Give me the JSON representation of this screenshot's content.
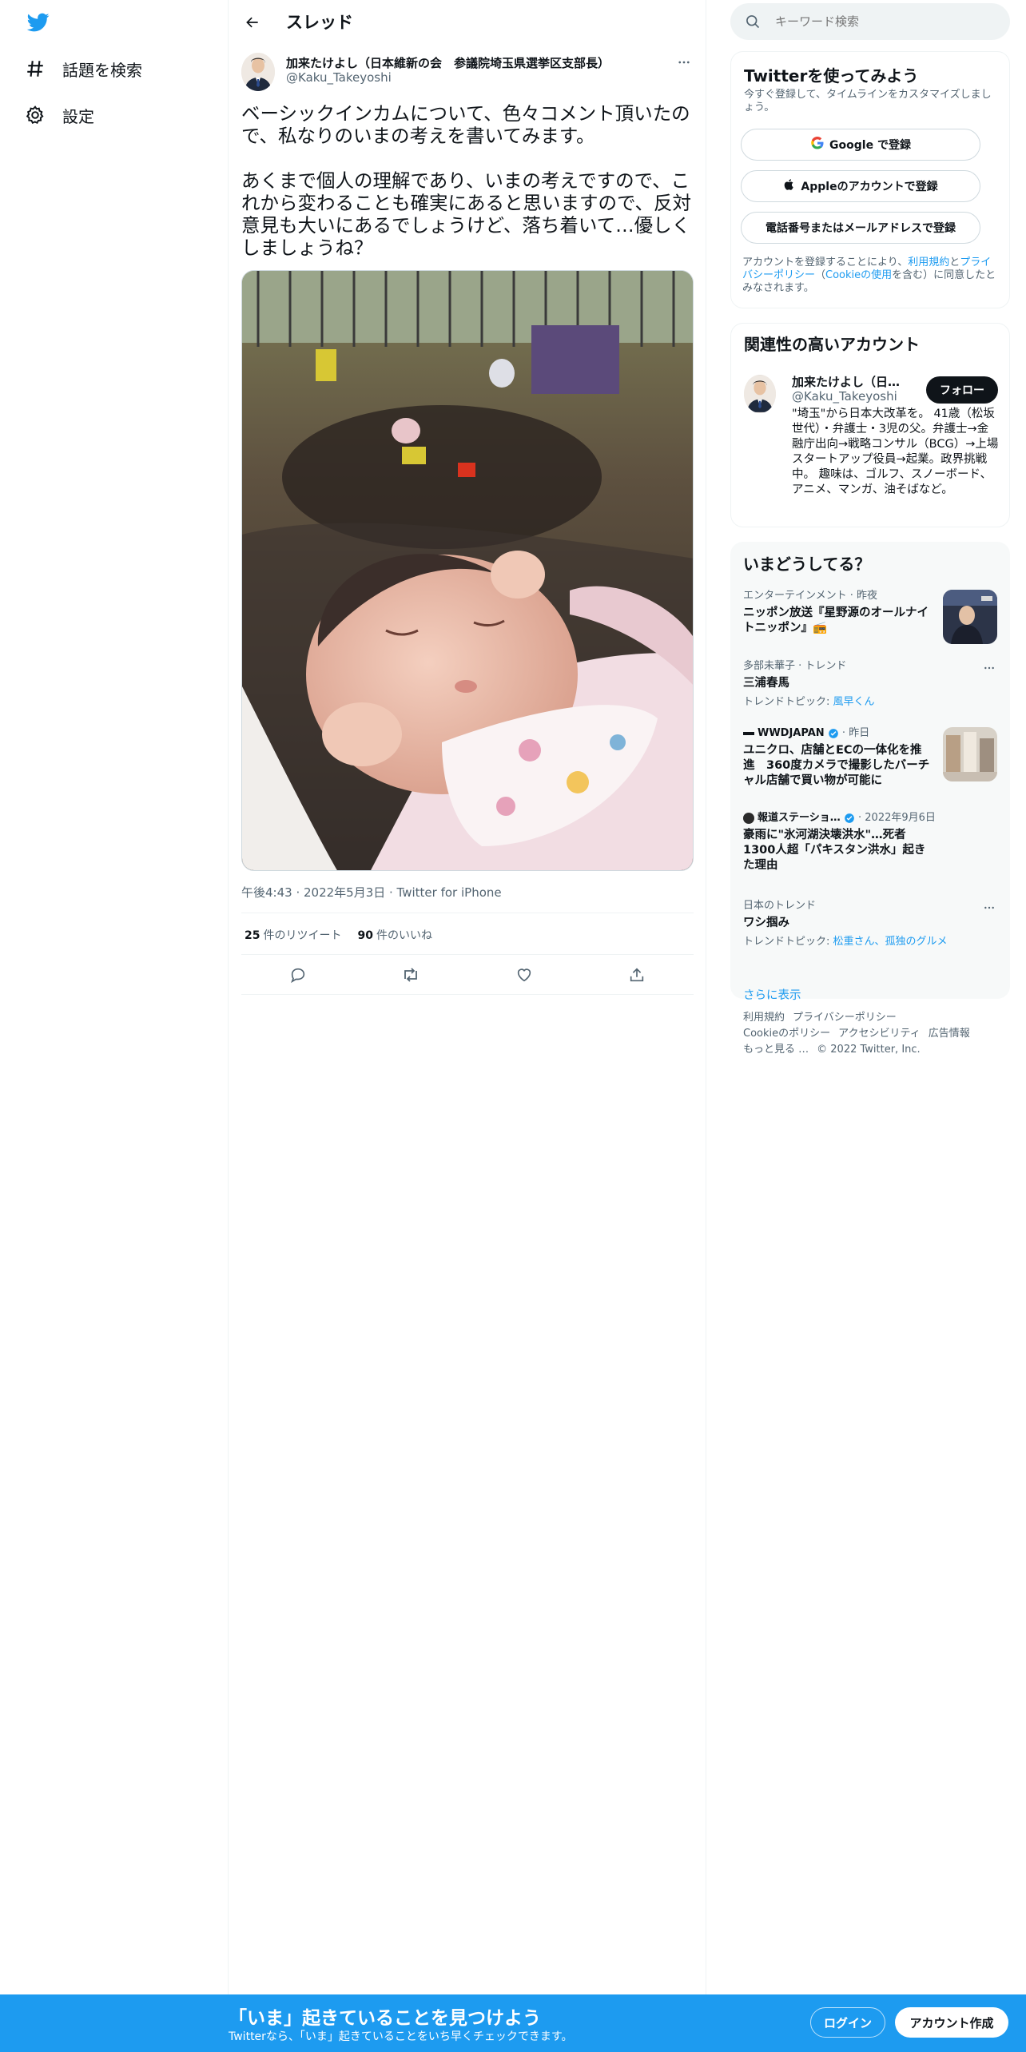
{
  "nav": {
    "logo_icon": "twitter-bird-icon",
    "explore_label": "話題を検索",
    "settings_label": "設定"
  },
  "main": {
    "header_title": "スレッド",
    "author_name": "加来たけよし（日本維新の会　参議院埼玉県選挙区支部長）",
    "author_handle": "@Kaku_Takeyoshi",
    "tweet_text": "ベーシックインカムについて、色々コメント頂いたので、私なりのいまの考えを書いてみます。\n\nあくまで個人の理解であり、いまの考えですので、これから変わることも確実にあると思いますので、反対意見も大いにあるでしょうけど、落ち着いて…優しくしましょうね？",
    "meta": "午後4:43 · 2022年5月3日 · Twitter for iPhone",
    "retweet_count": "25",
    "retweet_label": "件のリツイート",
    "like_count": "90",
    "like_label": "件のいいね"
  },
  "right": {
    "search_placeholder": "キーワード検索",
    "signup": {
      "title": "Twitterを使ってみよう",
      "subtitle": "今すぐ登録して、タイムラインをカスタマイズしましょう。",
      "google_label": "Google で登録",
      "apple_label": "Appleのアカウントで登録",
      "phone_label": "電話番号またはメールアドレスで登録",
      "legal_prefix": "アカウントを登録することにより、",
      "legal_terms": "利用規約",
      "legal_and": "と",
      "legal_privacy": "プライバシーポリシー",
      "legal_paren_open": "（",
      "legal_cookie": "Cookieの使用",
      "legal_suffix": "を含む）に同意したとみなされます。"
    },
    "related": {
      "title": "関連性の高いアカウント",
      "name": "加来たけよし（日本維新の会　参議院埼玉県選挙区支部長）",
      "handle": "@Kaku_Takeyoshi",
      "follow_label": "フォロー",
      "bio": "\"埼玉\"から日本大改革を。 41歳（松坂世代）・弁護士・3児の父。弁護士→金融庁出向→戦略コンサル（BCG）→上場スタートアップ役員→起業。政界挑戦中。 趣味は、ゴルフ、スノーボード、アニメ、マンガ、油そばなど。"
    },
    "trends": {
      "title": "いまどうしてる？",
      "items": [
        {
          "category": "エンターテインメント · 昨夜",
          "title": "ニッポン放送『星野源のオールナイトニッポン』📻",
          "sub": ""
        },
        {
          "category": "多部未華子 · トレンド",
          "title": "三浦春馬",
          "sub_prefix": "トレンドトピック: ",
          "sub": "風早くん"
        },
        {
          "category": "WWDJAPAN",
          "category_suffix": " · 昨日",
          "title": "ユニクロ、店舗とECの一体化を推進　360度カメラで撮影したバーチャル店舗で買い物が可能に",
          "sub": ""
        },
        {
          "category": "報道ステーショ…",
          "category_suffix": " · 2022年9月6日",
          "title": "豪雨に\"氷河湖決壊洪水\"…死者1300人超「パキスタン洪水」起きた理由",
          "sub": ""
        },
        {
          "category": "日本のトレンド",
          "title": "ワシ掴み",
          "sub_prefix": "トレンドトピック: ",
          "sub": "松重さん、孤独のグルメ"
        }
      ],
      "more_label": "さらに表示"
    },
    "footer": {
      "terms": "利用規約",
      "privacy": "プライバシーポリシー",
      "cookie": "Cookieのポリシー",
      "accessibility": "アクセシビリティ",
      "ads": "広告情報",
      "more": "もっと見る …",
      "copyright": "© 2022 Twitter, Inc."
    }
  },
  "bottom": {
    "title": "「いま」起きていることを見つけよう",
    "subtitle": "Twitterなら、「いま」起きていることをいち早くチェックできます。",
    "login_label": "ログイン",
    "signup_label": "アカウント作成"
  },
  "colors": {
    "accent": "#1d9bf0",
    "text": "#0f1419",
    "muted": "#536471"
  }
}
